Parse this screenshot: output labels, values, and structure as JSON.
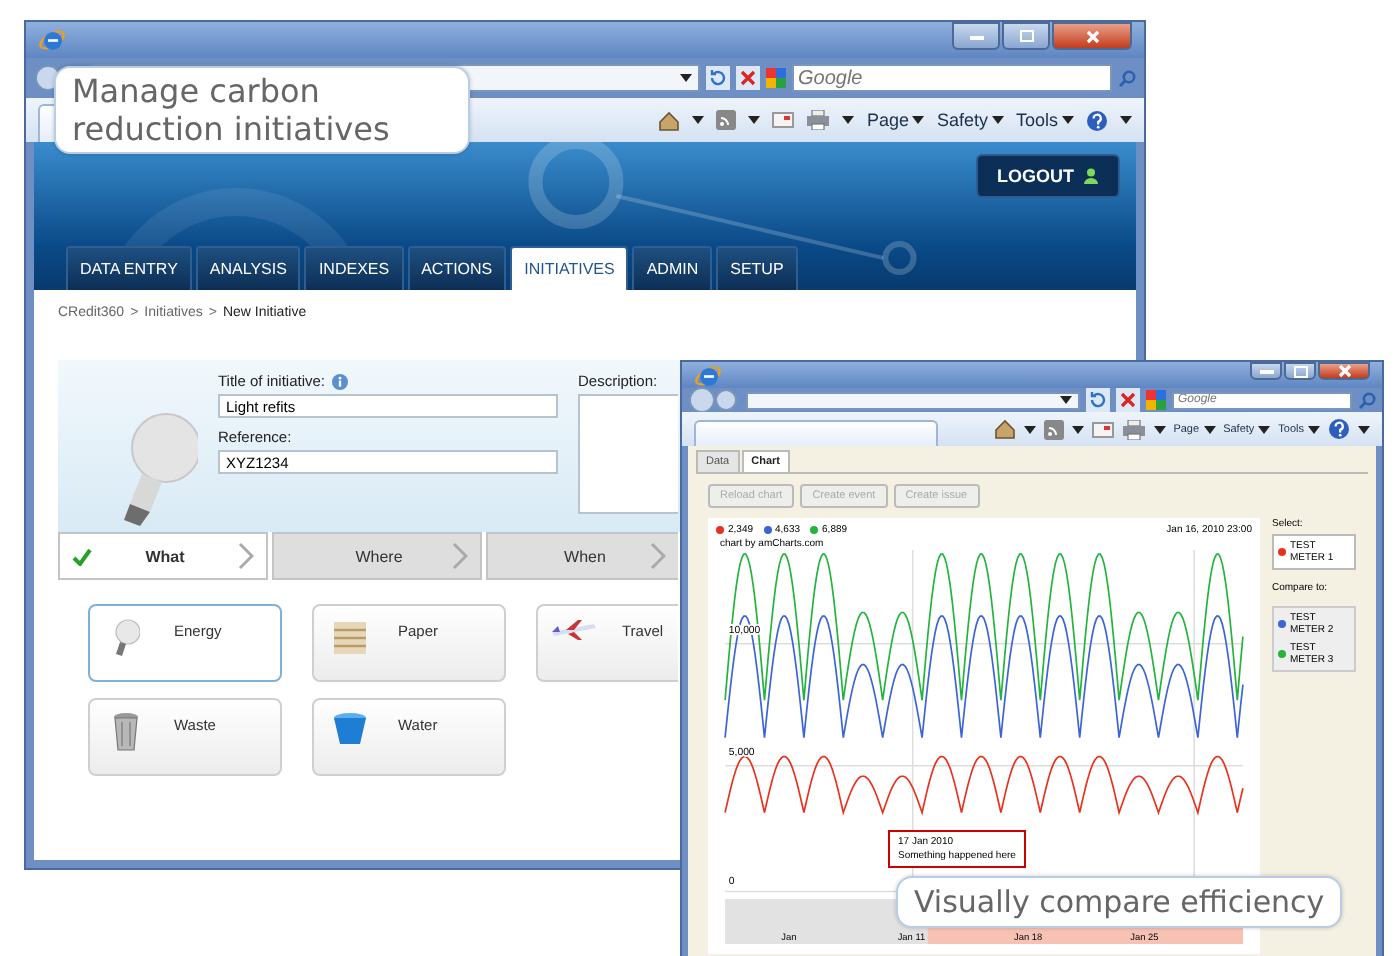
{
  "main_window": {
    "search_placeholder": "Google",
    "command_bar": [
      "Page",
      "Safety",
      "Tools"
    ],
    "logout": "LOGOUT",
    "tabs": [
      {
        "label": "DATA ENTRY",
        "selected": false
      },
      {
        "label": "ANALYSIS",
        "selected": false
      },
      {
        "label": "INDEXES",
        "selected": false
      },
      {
        "label": "ACTIONS",
        "selected": false
      },
      {
        "label": "INITIATIVES",
        "selected": true
      },
      {
        "label": "ADMIN",
        "selected": false
      },
      {
        "label": "SETUP",
        "selected": false
      }
    ],
    "breadcrumb": {
      "items": [
        "CRedit360",
        "Initiatives",
        "New Initiative"
      ],
      "separators": [
        ">",
        ">"
      ]
    },
    "form": {
      "title_label": "Title of initiative:",
      "title_value": "Light refits",
      "reference_label": "Reference:",
      "reference_value": "XYZ1234",
      "description_label": "Description:"
    },
    "steps": [
      {
        "label": "What",
        "selected": true,
        "done": true
      },
      {
        "label": "Where",
        "selected": false,
        "done": false
      },
      {
        "label": "When",
        "selected": false,
        "done": false
      }
    ],
    "categories": [
      {
        "label": "Energy",
        "kind": "bulb",
        "selected": true
      },
      {
        "label": "Paper",
        "kind": "paper",
        "selected": false
      },
      {
        "label": "Travel",
        "kind": "plane",
        "selected": false
      },
      {
        "label": "Waste",
        "kind": "bin",
        "selected": false
      },
      {
        "label": "Water",
        "kind": "bucket",
        "selected": false
      }
    ]
  },
  "chart_window": {
    "search_placeholder": "Google",
    "command_bar": [
      "Page",
      "Safety",
      "Tools"
    ],
    "tabs": [
      {
        "label": "Data",
        "selected": false
      },
      {
        "label": "Chart",
        "selected": true
      }
    ],
    "buttons": [
      {
        "label": "Reload chart",
        "disabled": true
      },
      {
        "label": "Create event",
        "disabled": true
      },
      {
        "label": "Create issue",
        "disabled": true
      }
    ],
    "chart": {
      "legend": [
        {
          "value": "2,349",
          "color": "#e8321e"
        },
        {
          "value": "4,633",
          "color": "#3c64d8"
        },
        {
          "value": "6,889",
          "color": "#22b43c"
        }
      ],
      "timestamp": "Jan 16, 2010 23:00",
      "credit": "chart by amCharts.com",
      "y_labels": [
        "10,000",
        "5,000",
        "0"
      ],
      "x_labels": [
        "Jan",
        "Jan 11",
        "Jan 18",
        "Jan 25"
      ],
      "event": {
        "date": "17 Jan 2010",
        "text": "Something happened here"
      }
    },
    "select_label": "Select:",
    "selected_meter": {
      "label": "TEST METER 1",
      "color": "#e8321e"
    },
    "compare_label": "Compare to:",
    "compare": [
      {
        "label": "TEST METER 2",
        "color": "#3c64d8"
      },
      {
        "label": "TEST METER 3",
        "color": "#22b43c"
      }
    ]
  },
  "callouts": [
    {
      "text": "Manage carbon reduction initiatives"
    },
    {
      "text": "Visually compare efficiency"
    }
  ]
}
